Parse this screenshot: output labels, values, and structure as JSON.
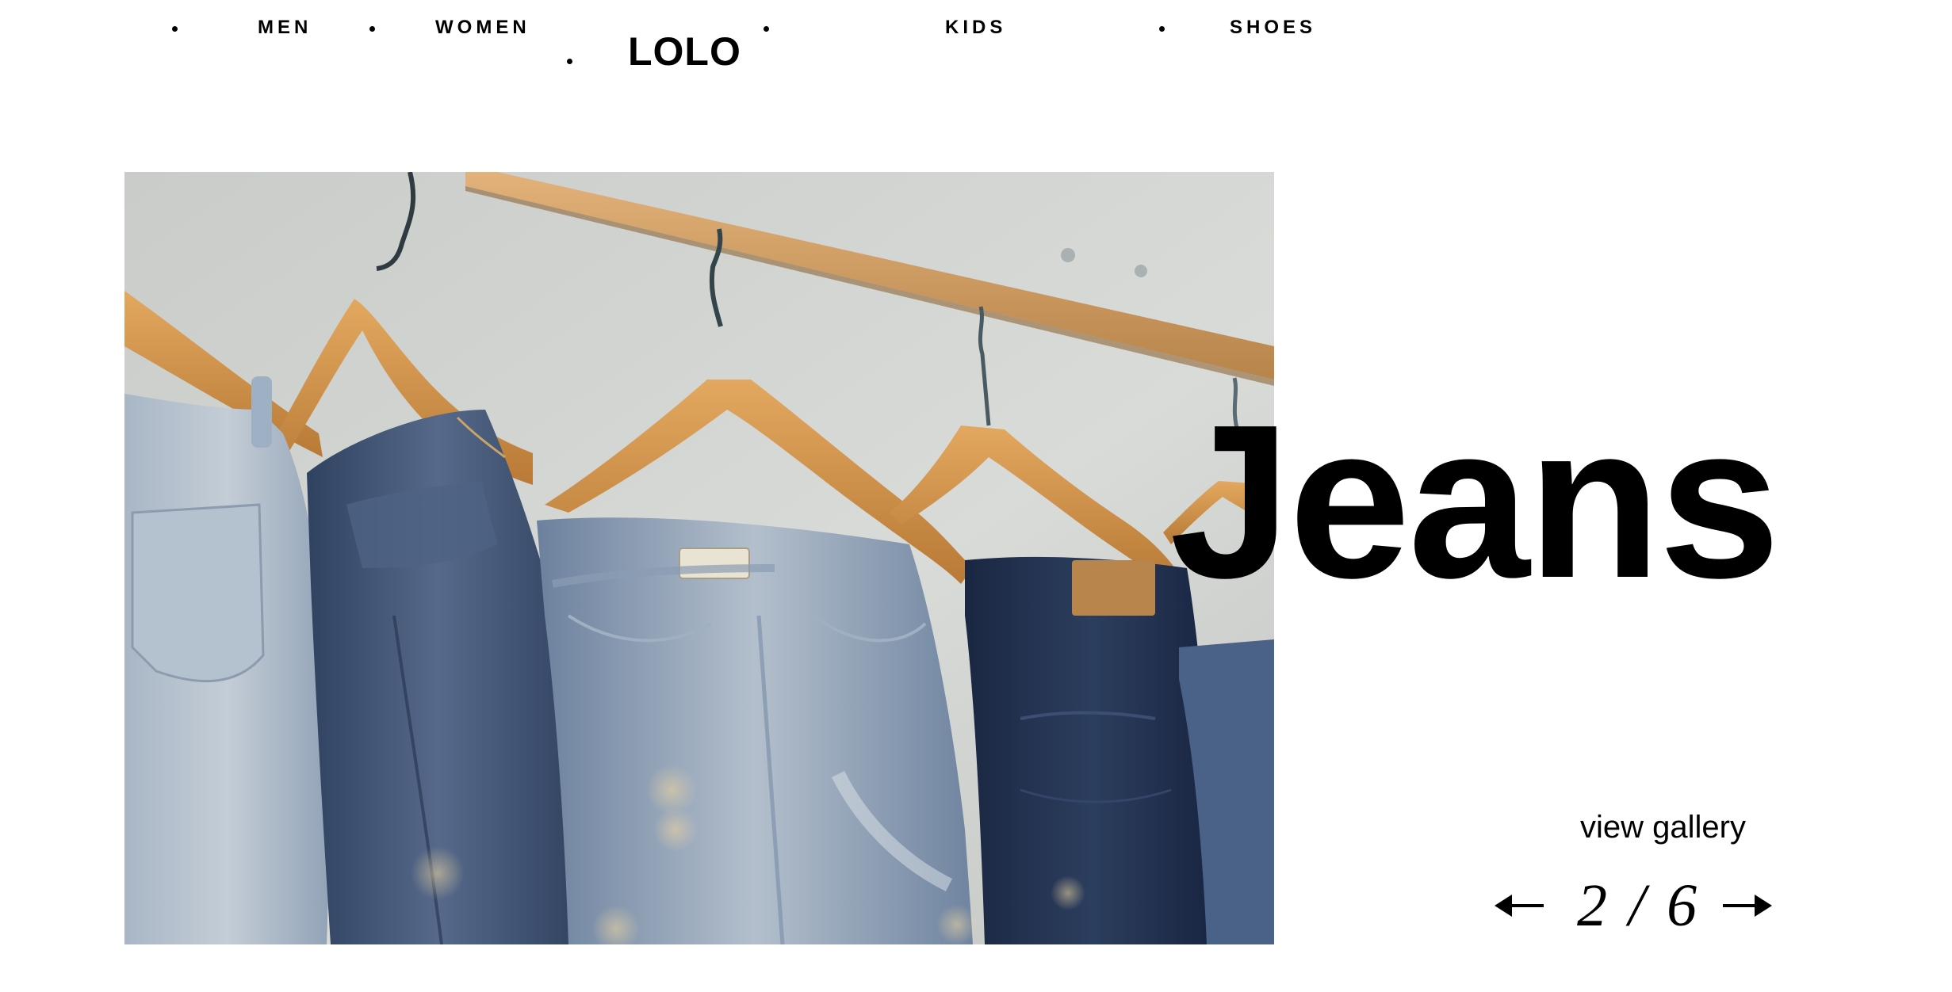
{
  "brand": {
    "logo": "LOLO"
  },
  "nav": {
    "items": [
      {
        "label": "MEN"
      },
      {
        "label": "WOMEN"
      },
      {
        "label": "KIDS"
      },
      {
        "label": "SHOES"
      }
    ]
  },
  "hero": {
    "title": "Jeans",
    "photo_subject": "jeans hanging on wooden hangers",
    "view_gallery_label": "view gallery",
    "pager": {
      "current": 2,
      "total": 6,
      "text": "2 / 6",
      "prev_icon": "arrow-left-icon",
      "next_icon": "arrow-right-icon"
    }
  },
  "colors": {
    "text": "#000000",
    "background": "#ffffff",
    "wood": "#d29a55",
    "wall": "#cfd1cd",
    "denim_light": "#8ea4bc",
    "denim_mid": "#3f5674",
    "denim_dark": "#1e2c45"
  }
}
